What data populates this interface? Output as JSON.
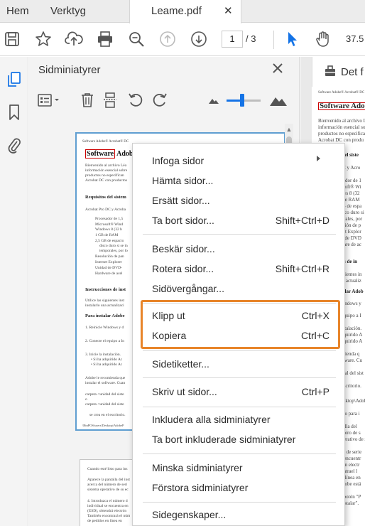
{
  "tabs": {
    "home": "Hem",
    "tools": "Verktyg",
    "document": "Leame.pdf"
  },
  "toolbar": {
    "page_current": "1",
    "page_total": "/ 3",
    "zoom": "37.5"
  },
  "panel": {
    "title": "Sidminiatyrer",
    "slider_level": 0.45
  },
  "right_pane": {
    "title": "Det f",
    "doc_lines": [
      "Software Adobe® Acrobat® DC",
      "Software Adobe",
      "Bienvenido al archivo L",
      "información esencial so",
      "productos no especifica",
      "Acrobat DC con produ",
      "s del siste",
      "DC y Acro",
      "esador de 1",
      "rosoft® Wi",
      "lows 8 (32",
      "8 de RAM",
      "GB de espa",
      "disco duro si se",
      "porales, por",
      "lución de p",
      "rnet Explor",
      "ad de DVD",
      "lware de ac",
      "nes de in",
      "iguientes in",
      "ras actualiz",
      "stalar Adob",
      "Windows y",
      "l equipo a I",
      "instalación.",
      "adquirido A",
      "adquirido A",
      "omienda q",
      "oftware. Cu",
      "ladal del sist",
      "l escritorio.",
      "desktop\\Adobe",
      "listo para i",
      "ntalla del",
      "úmero de s",
      "operativo de su",
      "ero de serie",
      "ra encuentr",
      "ción electr",
      "contrael l",
      "on línea en",
      "Adobe está",
      "el botón \"P",
      "\"instalar\"."
    ]
  },
  "thumbnail": {
    "header": "Software Adobe® Acrobat® DC",
    "title_boxed": "Software",
    "title_rest": "Adobe",
    "lines": [
      "Bienvenido al archivo Léa",
      "información esencial sobre",
      "productos no especifican",
      "Acrobat DC con productos"
    ],
    "section1": "Requisitos del sistem",
    "intro": "Acrobat Pro DC y Acroba",
    "bullets": [
      "Procesador de 1,5",
      "Microsoft® Wind",
      "Windows 8 (32 b",
      "1 GB de RAM",
      "2,5 GB de espacio",
      "disco duro si se in",
      "temporales, por lo",
      "Resolución de pan",
      "Internet Explorer",
      "Unidad de DVD-",
      "Hardware de acel"
    ],
    "section2": "Instrucciones de inst",
    "p2": [
      "Utilice las siguientes inst",
      "instalarlo una actualizaci"
    ],
    "section3": "Para instalar Adobe",
    "steps": [
      "1. Reinicie Windows y d",
      "2. Conecte el equipo a In",
      "3. Inicie la instalación.",
      "• Si ha adquirido Ac",
      "• Si ha adquirido Ac"
    ],
    "p3": [
      "Adobe le recomienda que",
      "instalar el software. Cuan"
    ],
    "p4": [
      "carpeta <unidad del siste",
      "o",
      "carpeta <unidad del siste"
    ],
    "p5": "se crea en el escritorio.",
    "footer": "\\BinPOS\\users\\Desktop\\AdobeP",
    "page2": [
      "Cuando esté listo para ins",
      "Aparece la pantalla del inst",
      "acerca del número de seri",
      "sistema operativo de su ec",
      "4. Introduzca el número d",
      "individual se encuentra en",
      "(ESD), obtendrá electrón",
      "También encontrará el núm",
      "de pedidos en línea en"
    ]
  },
  "context_menu": {
    "items": [
      {
        "label": "Infoga sidor",
        "shortcut": "",
        "submenu": true
      },
      {
        "label": "Hämta sidor...",
        "shortcut": ""
      },
      {
        "label": "Ersätt sidor...",
        "shortcut": ""
      },
      {
        "label": "Ta bort sidor...",
        "shortcut": "Shift+Ctrl+D"
      },
      {
        "label": "Beskär sidor...",
        "shortcut": ""
      },
      {
        "label": "Rotera sidor...",
        "shortcut": "Shift+Ctrl+R"
      },
      {
        "label": "Sidövergångar...",
        "shortcut": ""
      },
      {
        "label": "Klipp ut",
        "shortcut": "Ctrl+X"
      },
      {
        "label": "Kopiera",
        "shortcut": "Ctrl+C"
      },
      {
        "label": "Sidetiketter...",
        "shortcut": ""
      },
      {
        "label": "Skriv ut sidor...",
        "shortcut": "Ctrl+P"
      },
      {
        "label": "Inkludera alla sidminiatyrer",
        "shortcut": ""
      },
      {
        "label": "Ta bort inkluderade sidminiatyrer",
        "shortcut": ""
      },
      {
        "label": "Minska sidminiatyrer",
        "shortcut": ""
      },
      {
        "label": "Förstora sidminiatyrer",
        "shortcut": ""
      },
      {
        "label": "Sidegenskaper...",
        "shortcut": ""
      }
    ]
  },
  "colors": {
    "accent": "#1473e6",
    "highlight": "#e8852a",
    "selection_border": "#5f9ed1"
  }
}
